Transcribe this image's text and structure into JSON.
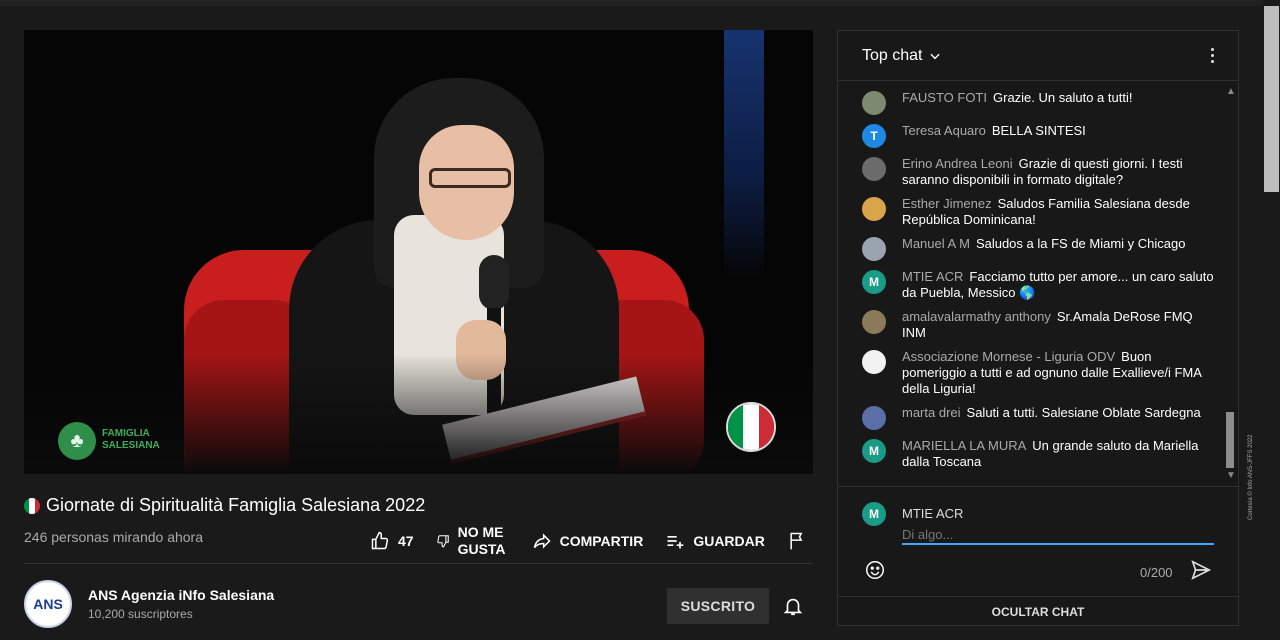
{
  "video": {
    "logo_icon": "tree-icon",
    "logo_line1": "FAMIGLIA",
    "logo_line2": "SALESIANA",
    "flag_colors": [
      "#009246",
      "#ffffff",
      "#ce2b37"
    ]
  },
  "info": {
    "title": "Giornate di Spiritualità Famiglia Salesiana 2022",
    "viewers": "246 personas mirando ahora",
    "like_count": "47",
    "dislike_label": "NO ME GUSTA",
    "share_label": "COMPARTIR",
    "save_label": "GUARDAR"
  },
  "channel": {
    "avatar_text": "ANS",
    "name": "ANS Agenzia iNfo Salesiana",
    "subscribers": "10,200 suscriptores",
    "subscribe_label": "SUSCRITO"
  },
  "chat": {
    "title": "Top chat",
    "messages": [
      {
        "author": "FAUSTO FOTI",
        "text": "Grazie. Un saluto a tutti!",
        "avatar": "",
        "color": "#7d8a70"
      },
      {
        "author": "Teresa Aquaro",
        "text": "BELLA SINTESI",
        "avatar": "T",
        "color": "#1e88e5"
      },
      {
        "author": "Erino Andrea Leoni",
        "text": "Grazie di questi giorni. I testi saranno disponibili in formato digitale?",
        "avatar": "",
        "color": "#6b6b6b"
      },
      {
        "author": "Esther Jimenez",
        "text": "Saludos Familia Salesiana desde República Dominicana!",
        "avatar": "",
        "color": "#d9a44a"
      },
      {
        "author": "Manuel A M",
        "text": "Saludos a la FS de Miami y Chicago",
        "avatar": "",
        "color": "#9aa4b0"
      },
      {
        "author": "MTIE ACR",
        "text": "Facciamo tutto per amore... un caro saluto da Puebla, Messico 🌎",
        "avatar": "M",
        "color": "#1a9b86"
      },
      {
        "author": "amalavalarmathy anthony",
        "text": "Sr.Amala DeRose FMQ INM",
        "avatar": "",
        "color": "#8a7a5a"
      },
      {
        "author": "Associazione Mornese - Liguria ODV",
        "text": "Buon pomeriggio a tutti e ad ognuno dalle Exallieve/i FMA della Liguria!",
        "avatar": "",
        "color": "#f2f2f2"
      },
      {
        "author": "marta drei",
        "text": "Saluti a tutti. Salesiane Oblate Sardegna",
        "avatar": "",
        "color": "#5a6fa8"
      },
      {
        "author": "MARIELLA LA MURA",
        "text": "Un grande saluto da Mariella dalla Toscana",
        "avatar": "M",
        "color": "#1a9b86"
      }
    ],
    "composer_user": "MTIE ACR",
    "composer_avatar": "M",
    "composer_placeholder": "Di algo...",
    "char_count": "0/200",
    "hide_label": "OCULTAR CHAT"
  },
  "credit": "Cortesía © Info ANS-JFFS 2022"
}
